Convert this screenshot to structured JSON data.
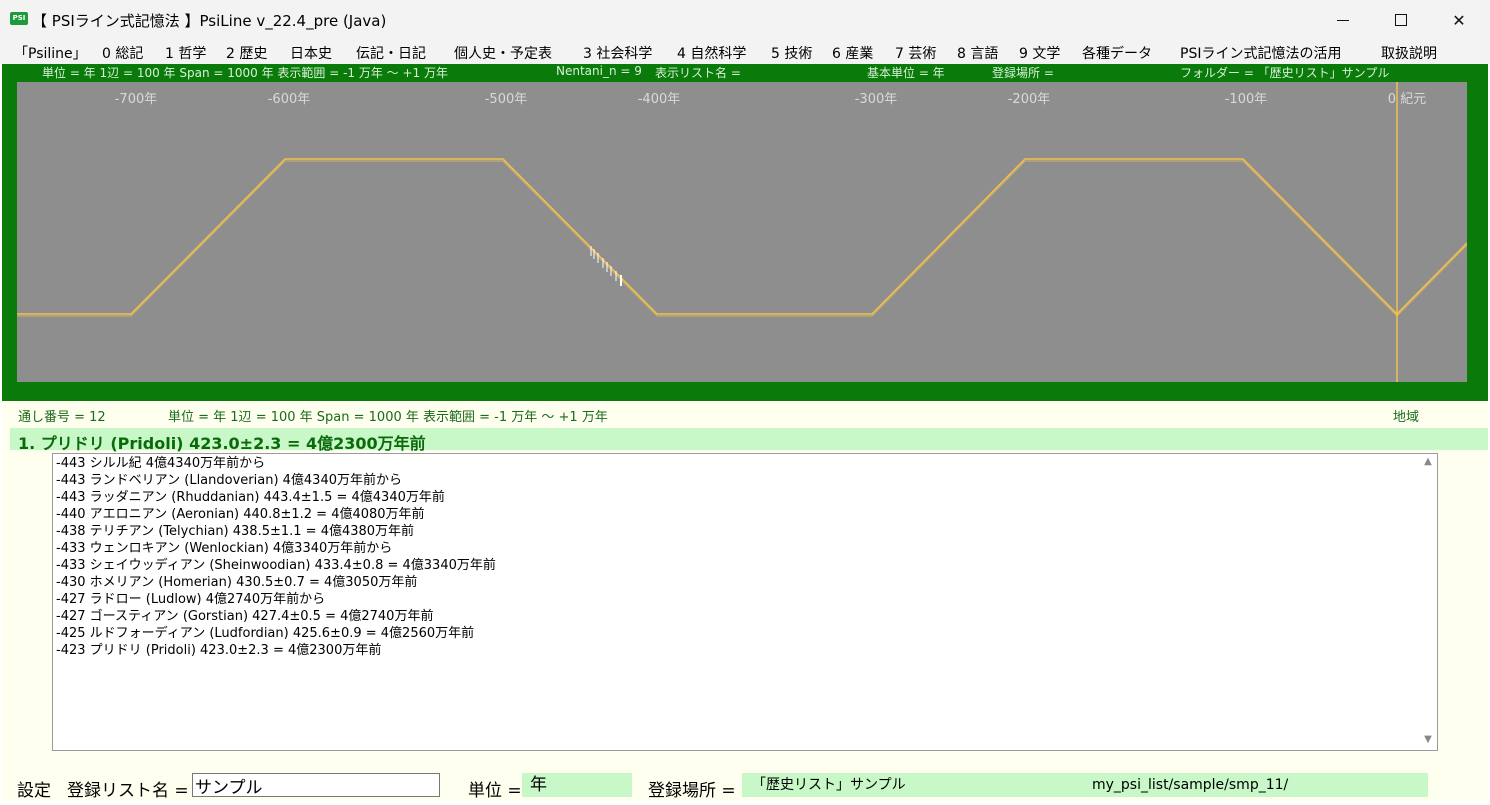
{
  "window": {
    "icon_text": "PSI",
    "title": "【 PSIライン式記憶法 】PsiLine v_22.4_pre (Java)",
    "minimize": "minimize-icon",
    "maximize": "maximize-icon",
    "close": "✕"
  },
  "menu": [
    "「Psiline」",
    "0 総記",
    "1 哲学",
    "2 歴史",
    "日本史",
    "伝記・日記",
    "個人史・予定表",
    "3 社会科学",
    "4 自然科学",
    "5 技術",
    "6 産業",
    "7 芸術",
    "8 言語",
    "9 文学",
    "各種データ",
    "PSIライン式記憶法の活用",
    "取扱説明"
  ],
  "timeline_info": {
    "unit_span": "単位 = 年  1辺 = 100 年  Span = 1000 年  表示範囲 = -1 万年 〜 +1 万年",
    "nentani": "Nentani_n = 9",
    "list_name": "表示リスト名 =",
    "base_unit": "基本単位 = 年",
    "location": "登録場所 =",
    "folder": "フォルダー = 「歴史リスト」サンプル"
  },
  "timeline": {
    "ticks": [
      "-700年",
      "-600年",
      "-500年",
      "-400年",
      "-300年",
      "-200年",
      "-100年",
      "0  紀元"
    ],
    "line_color": "#f0c050",
    "background": "#8e8e8e"
  },
  "status": {
    "serial": "通し番号 = 12",
    "unit_span": "単位 = 年  1辺 = 100 年  Span = 1000 年  表示範囲 = -1 万年 〜 +1 万年",
    "region": "地域"
  },
  "selected_item": "1. プリドリ (Pridoli) 423.0±2.3 = 4億2300万年前",
  "list_items": [
    "-443  シルル紀 4億4340万年前から",
    "-443  ランドベリアン (Llandoverian) 4億4340万年前から",
    "-443  ラッダニアン (Rhuddanian) 443.4±1.5 = 4億4340万年前",
    "-440  アエロニアン (Aeronian) 440.8±1.2 = 4億4080万年前",
    "-438  テリチアン (Telychian) 438.5±1.1 = 4億4380万年前",
    "-433  ウェンロキアン (Wenlockian) 4億3340万年前から",
    "-433  シェイウッディアン (Sheinwoodian) 433.4±0.8 = 4億3340万年前",
    "-430  ホメリアン (Homerian) 430.5±0.7 = 4億3050万年前",
    "-427  ラドロー (Ludlow) 4億2740万年前から",
    "-427  ゴースティアン (Gorstian) 427.4±0.5 = 4億2740万年前",
    "-425  ルドフォーディアン (Ludfordian) 425.6±0.9 = 4億2560万年前",
    "-423  プリドリ (Pridoli) 423.0±2.3 = 4億2300万年前"
  ],
  "bottom": {
    "settings": "設定",
    "list_name_label": "登録リスト名 =",
    "list_name_value": "サンプル",
    "unit_label": "単位 =",
    "unit_value": "年",
    "location_label": "登録場所 =",
    "location_value": "「歴史リスト」サンプル",
    "path_value": "my_psi_list/sample/smp_11/"
  }
}
